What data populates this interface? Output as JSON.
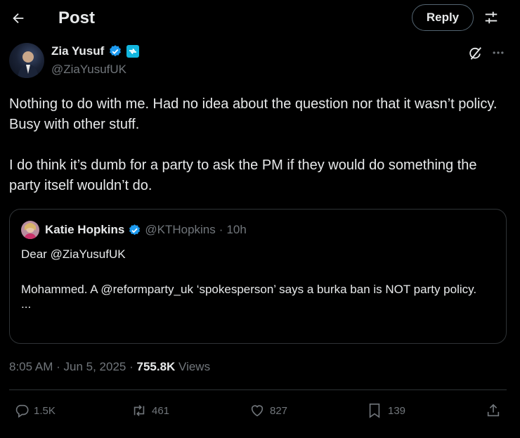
{
  "header": {
    "title": "Post",
    "reply_label": "Reply"
  },
  "post": {
    "author_name": "Zia Yusuf",
    "author_handle": "@ZiaYusufUK",
    "text_p1": "Nothing to do with me. Had no idea about the question nor that it wasn’t policy. Busy with other stuff.",
    "text_p2": "I do think it’s dumb for a party to ask the PM if they would do something the party itself wouldn’t do.",
    "time": "8:05 AM",
    "date": "Jun 5, 2025",
    "views_count": "755.8K",
    "views_label": "Views"
  },
  "quote": {
    "author_name": "Katie Hopkins",
    "author_handle": "@KTHopkins",
    "age": "10h",
    "line1": "Dear @ZiaYusufUK",
    "line2": "Mohammed. A @reformparty_uk ‘spokesperson’ says a burka ban is NOT party policy.",
    "ellipsis": "..."
  },
  "actions": {
    "replies": "1.5K",
    "reposts": "461",
    "likes": "827",
    "bookmarks": "139"
  },
  "colors": {
    "background": "#000000",
    "text": "#e7e9ea",
    "muted": "#71767b",
    "verified": "#1d9bf0",
    "border": "#2f3336"
  }
}
